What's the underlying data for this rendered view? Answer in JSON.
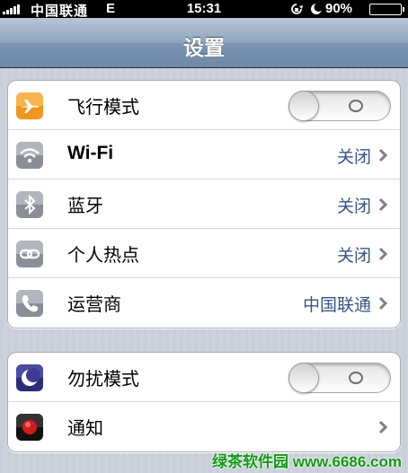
{
  "status_bar": {
    "carrier": "中国联通",
    "network": "E",
    "time": "15:31",
    "battery_percent": "90%",
    "battery_level": 0.9,
    "icons": [
      "signal-icon",
      "rotation-lock-icon",
      "moon-icon",
      "battery-icon"
    ]
  },
  "nav": {
    "title": "设置"
  },
  "group1": {
    "rows": [
      {
        "label": "飞行模式",
        "icon": "airplane-icon",
        "icon_color": "#f0961e",
        "control": "toggle",
        "on": false
      },
      {
        "label": "Wi-Fi",
        "icon": "wifi-icon",
        "icon_color": "#8a8e96",
        "value": "关闭"
      },
      {
        "label": "蓝牙",
        "icon": "bluetooth-icon",
        "icon_color": "#8a8e96",
        "value": "关闭"
      },
      {
        "label": "个人热点",
        "icon": "hotspot-icon",
        "icon_color": "#8a8e96",
        "value": "关闭"
      },
      {
        "label": "运营商",
        "icon": "phone-icon",
        "icon_color": "#8a8e96",
        "value": "中国联通"
      }
    ]
  },
  "group2": {
    "rows": [
      {
        "label": "勿扰模式",
        "icon": "moon-icon",
        "icon_color": "#35378a",
        "control": "toggle",
        "on": false
      },
      {
        "label": "通知",
        "icon": "notification-icon",
        "icon_color": "#d21c1c"
      }
    ]
  },
  "watermark": "绿茶软件园 www.6686.com",
  "colors": {
    "value_text": "#385487",
    "nav_bar": "#7c95b2"
  }
}
